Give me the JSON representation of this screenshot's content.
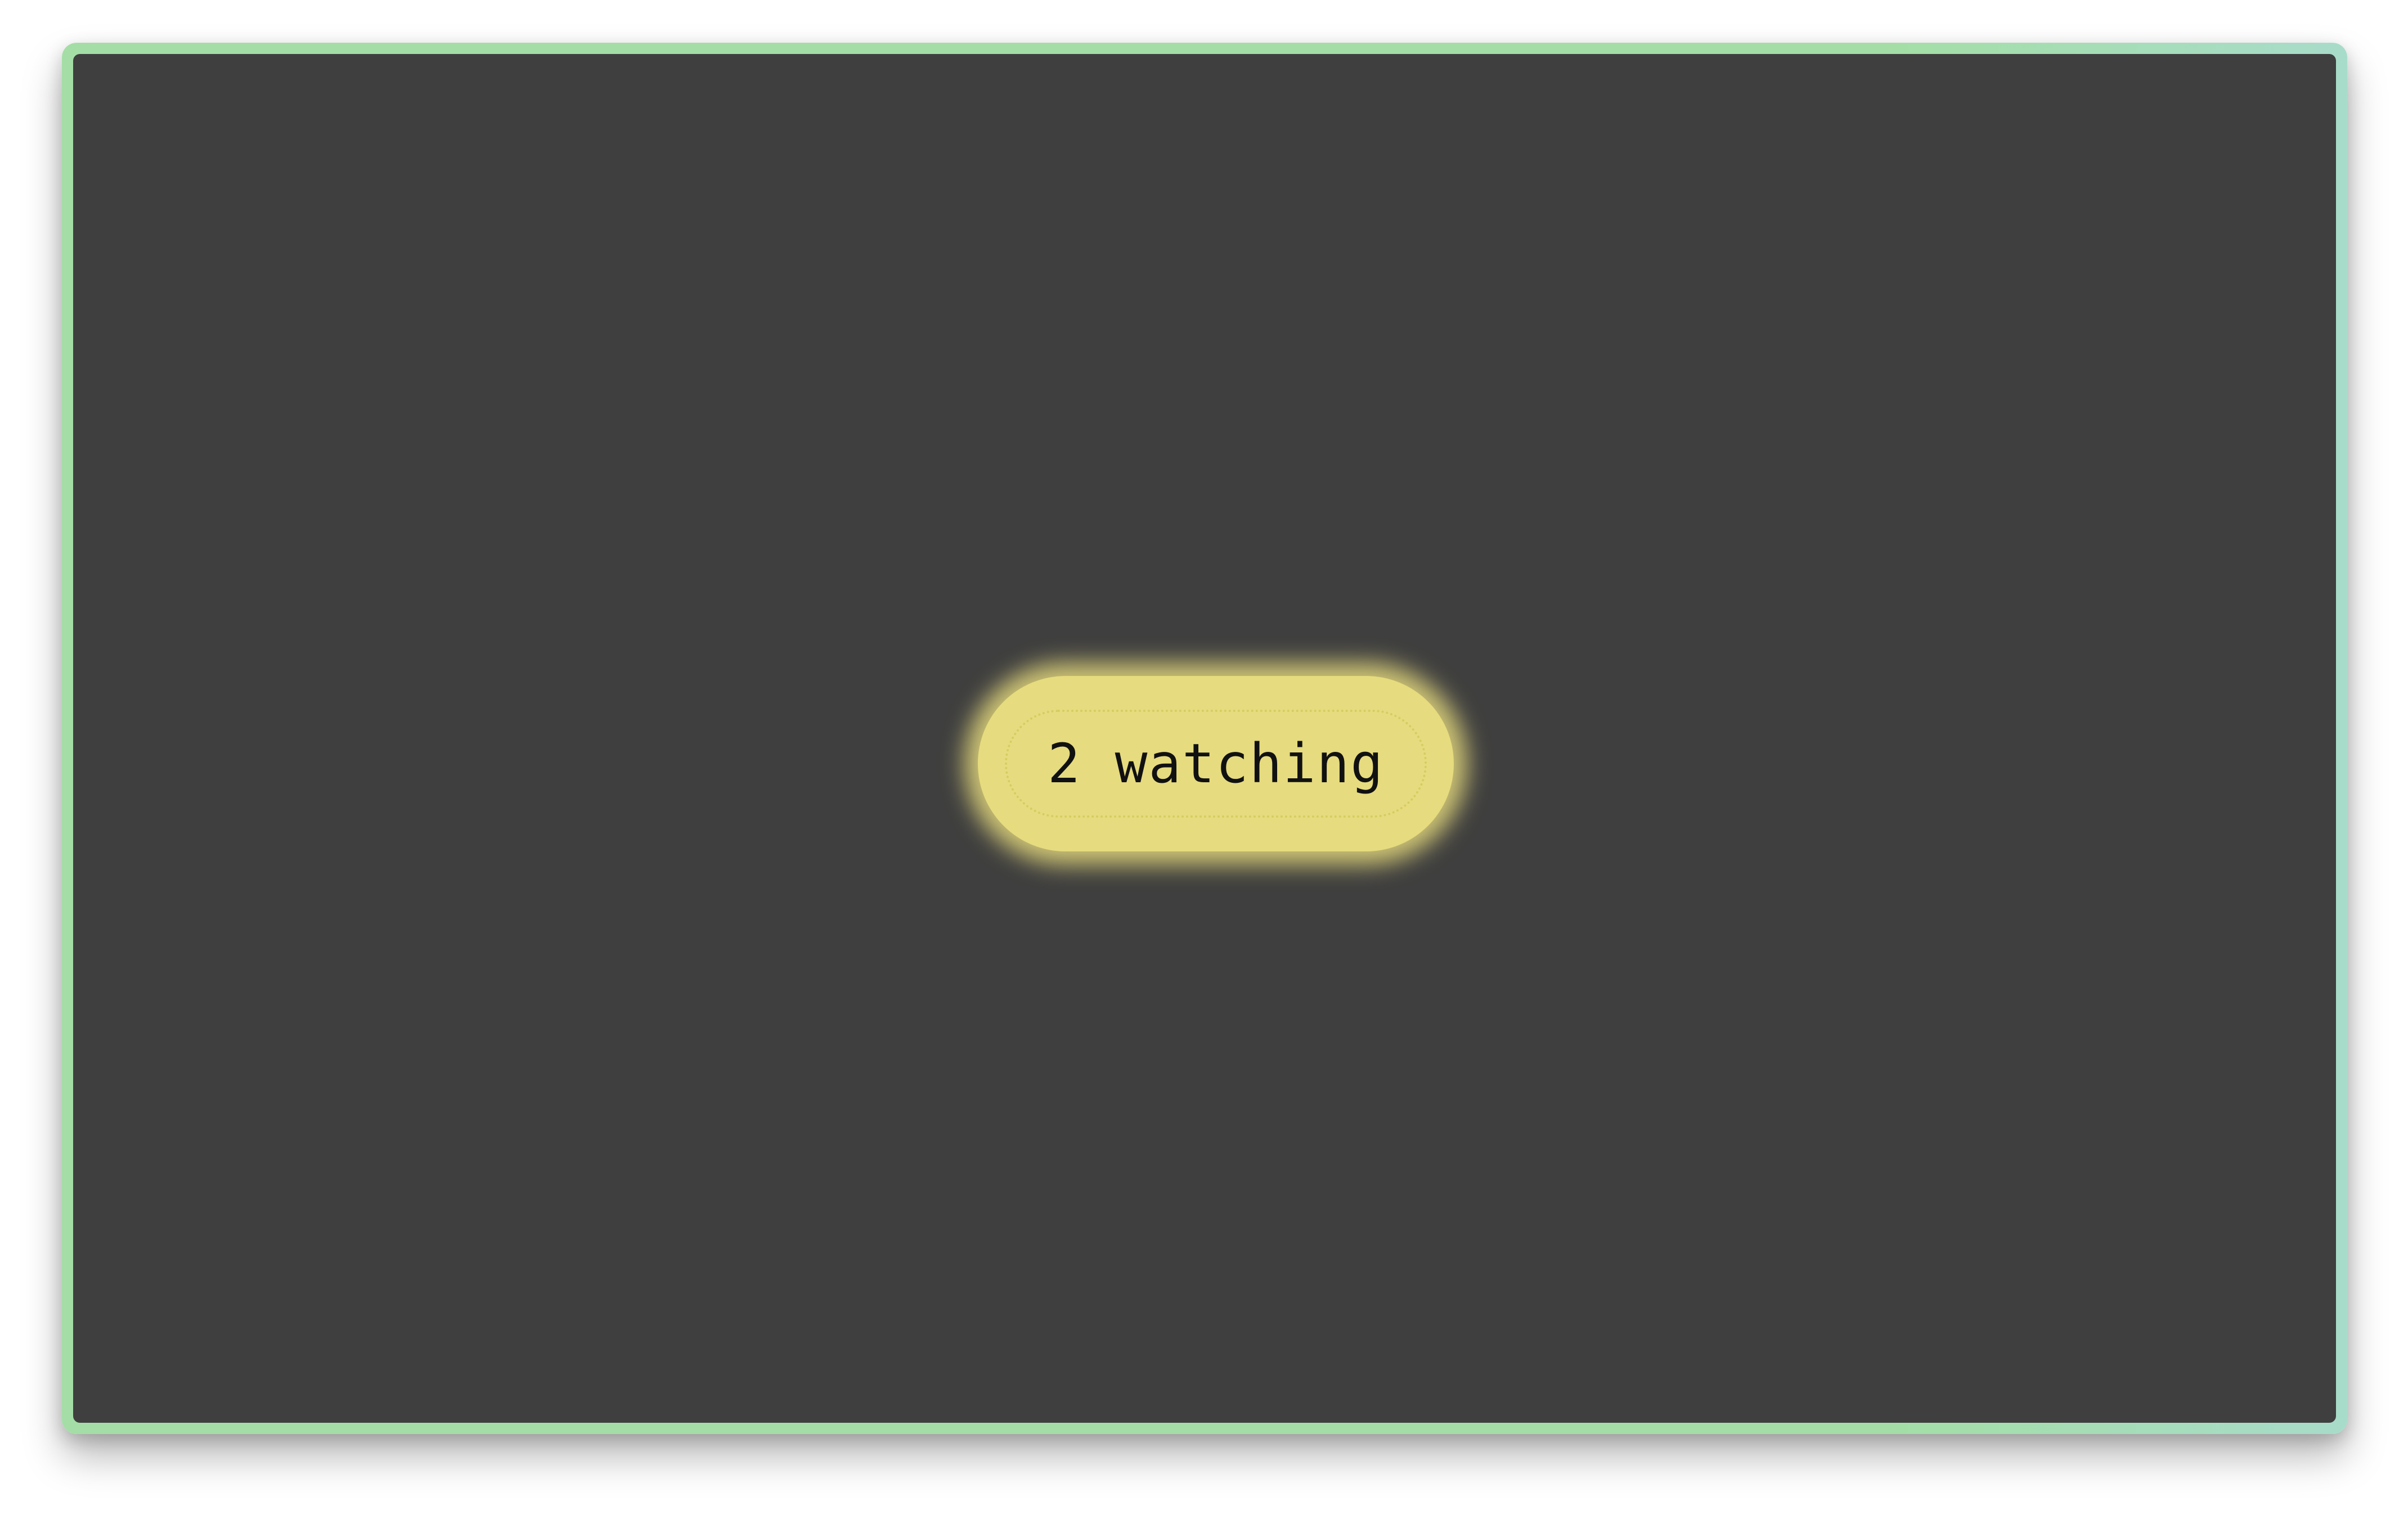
{
  "viewer_badge": {
    "label": "2 watching"
  },
  "colors": {
    "frame": "#a4dea6",
    "screen": "#3f3f3f",
    "badge": "#e6db7e"
  }
}
